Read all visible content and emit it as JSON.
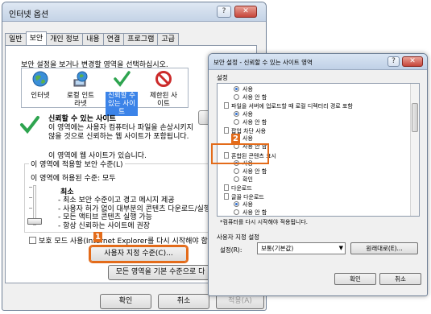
{
  "win1": {
    "title": "인터넷 옵션",
    "tabs": [
      "일반",
      "보안",
      "개인 정보",
      "내용",
      "연결",
      "프로그램",
      "고급"
    ],
    "zones_caption": "보안 설정을 보거나 변경할 영역을 선택하십시오.",
    "zones": [
      {
        "label": "인터넷",
        "icon": "globe-icon"
      },
      {
        "label": "로컬 인트라넷",
        "icon": "intranet-icon"
      },
      {
        "label": "신뢰할 수 있는 사이트",
        "icon": "checkmark-icon",
        "selected": true
      },
      {
        "label": "제한된 사이트",
        "icon": "restricted-icon"
      }
    ],
    "site_title": "신뢰할 수 있는 사이트",
    "site_desc": "이 영역에는 사용자 컴퓨터나 파일을 손상시키지 않을 것으로 신뢰하는 웹 사이트가 포함됩니다.",
    "site_none": "이 영역에 웹 사이트가 있습니다.",
    "level_legend": "이 영역에 적용할 보안 수준(L)",
    "level_allowed": "이 영역에 허용된 수준: 모두",
    "level_name": "최소",
    "level_items": [
      "- 최소 보안 수준이고 경고 메시지 제공",
      "- 사용자 허가 없이 대부분의 콘텐츠 다운로드/실행",
      "- 모든 액티브 콘텐츠 실행 가능",
      "- 항상 신뢰하는 사이트에 권장"
    ],
    "protected_mode": "보호 모드 사용(Internet Explorer를 다시 시작해야 함)(P)",
    "custom_level_button": "사용자 지정 수준(C)...",
    "default_level_button": "모든 영역을 기본 수준으로 다",
    "ok": "확인",
    "cancel": "취소",
    "apply": "적용(A)",
    "marker": "1"
  },
  "win2": {
    "title": "보안 설정 - 신뢰할 수 있는 사이트 영역",
    "settings_caption": "설정",
    "tree": [
      {
        "type": "radio",
        "on": true,
        "text": "사용"
      },
      {
        "type": "radio",
        "on": false,
        "text": "사용 안 함"
      },
      {
        "type": "item",
        "text": "파일을 서버에 업로드할 때 로컬 디렉터리 경로 포함"
      },
      {
        "type": "radio",
        "on": true,
        "text": "사용"
      },
      {
        "type": "radio",
        "on": false,
        "text": "사용 안 함"
      },
      {
        "type": "item",
        "text": "팝업 차단 사용"
      },
      {
        "type": "radio",
        "on": false,
        "text": "사용"
      },
      {
        "type": "radio",
        "on": false,
        "text": "사용 안 함"
      },
      {
        "type": "item",
        "text": "혼합된 콘텐츠 표시"
      },
      {
        "type": "radio",
        "on": true,
        "text": "사용"
      },
      {
        "type": "radio",
        "on": false,
        "text": "사용 안 함"
      },
      {
        "type": "radio",
        "on": false,
        "text": "확인"
      },
      {
        "type": "item",
        "text": "다운로드"
      },
      {
        "type": "item",
        "text": "글꼴 다운로드"
      },
      {
        "type": "radio",
        "on": true,
        "text": "사용"
      },
      {
        "type": "radio",
        "on": false,
        "text": "사용 안 함"
      }
    ],
    "note": "*컴퓨터를 다시 시작해야 적용됩니다.",
    "reset_caption": "사용자 지정 설정",
    "reset_label": "설정(R):",
    "reset_select": "보통(기본값)",
    "reset_button": "원래대로(E)...",
    "ok": "확인",
    "cancel": "취소",
    "marker": "2"
  },
  "colors": {
    "accent": "#e36b1a",
    "selection": "#3b83e8"
  }
}
